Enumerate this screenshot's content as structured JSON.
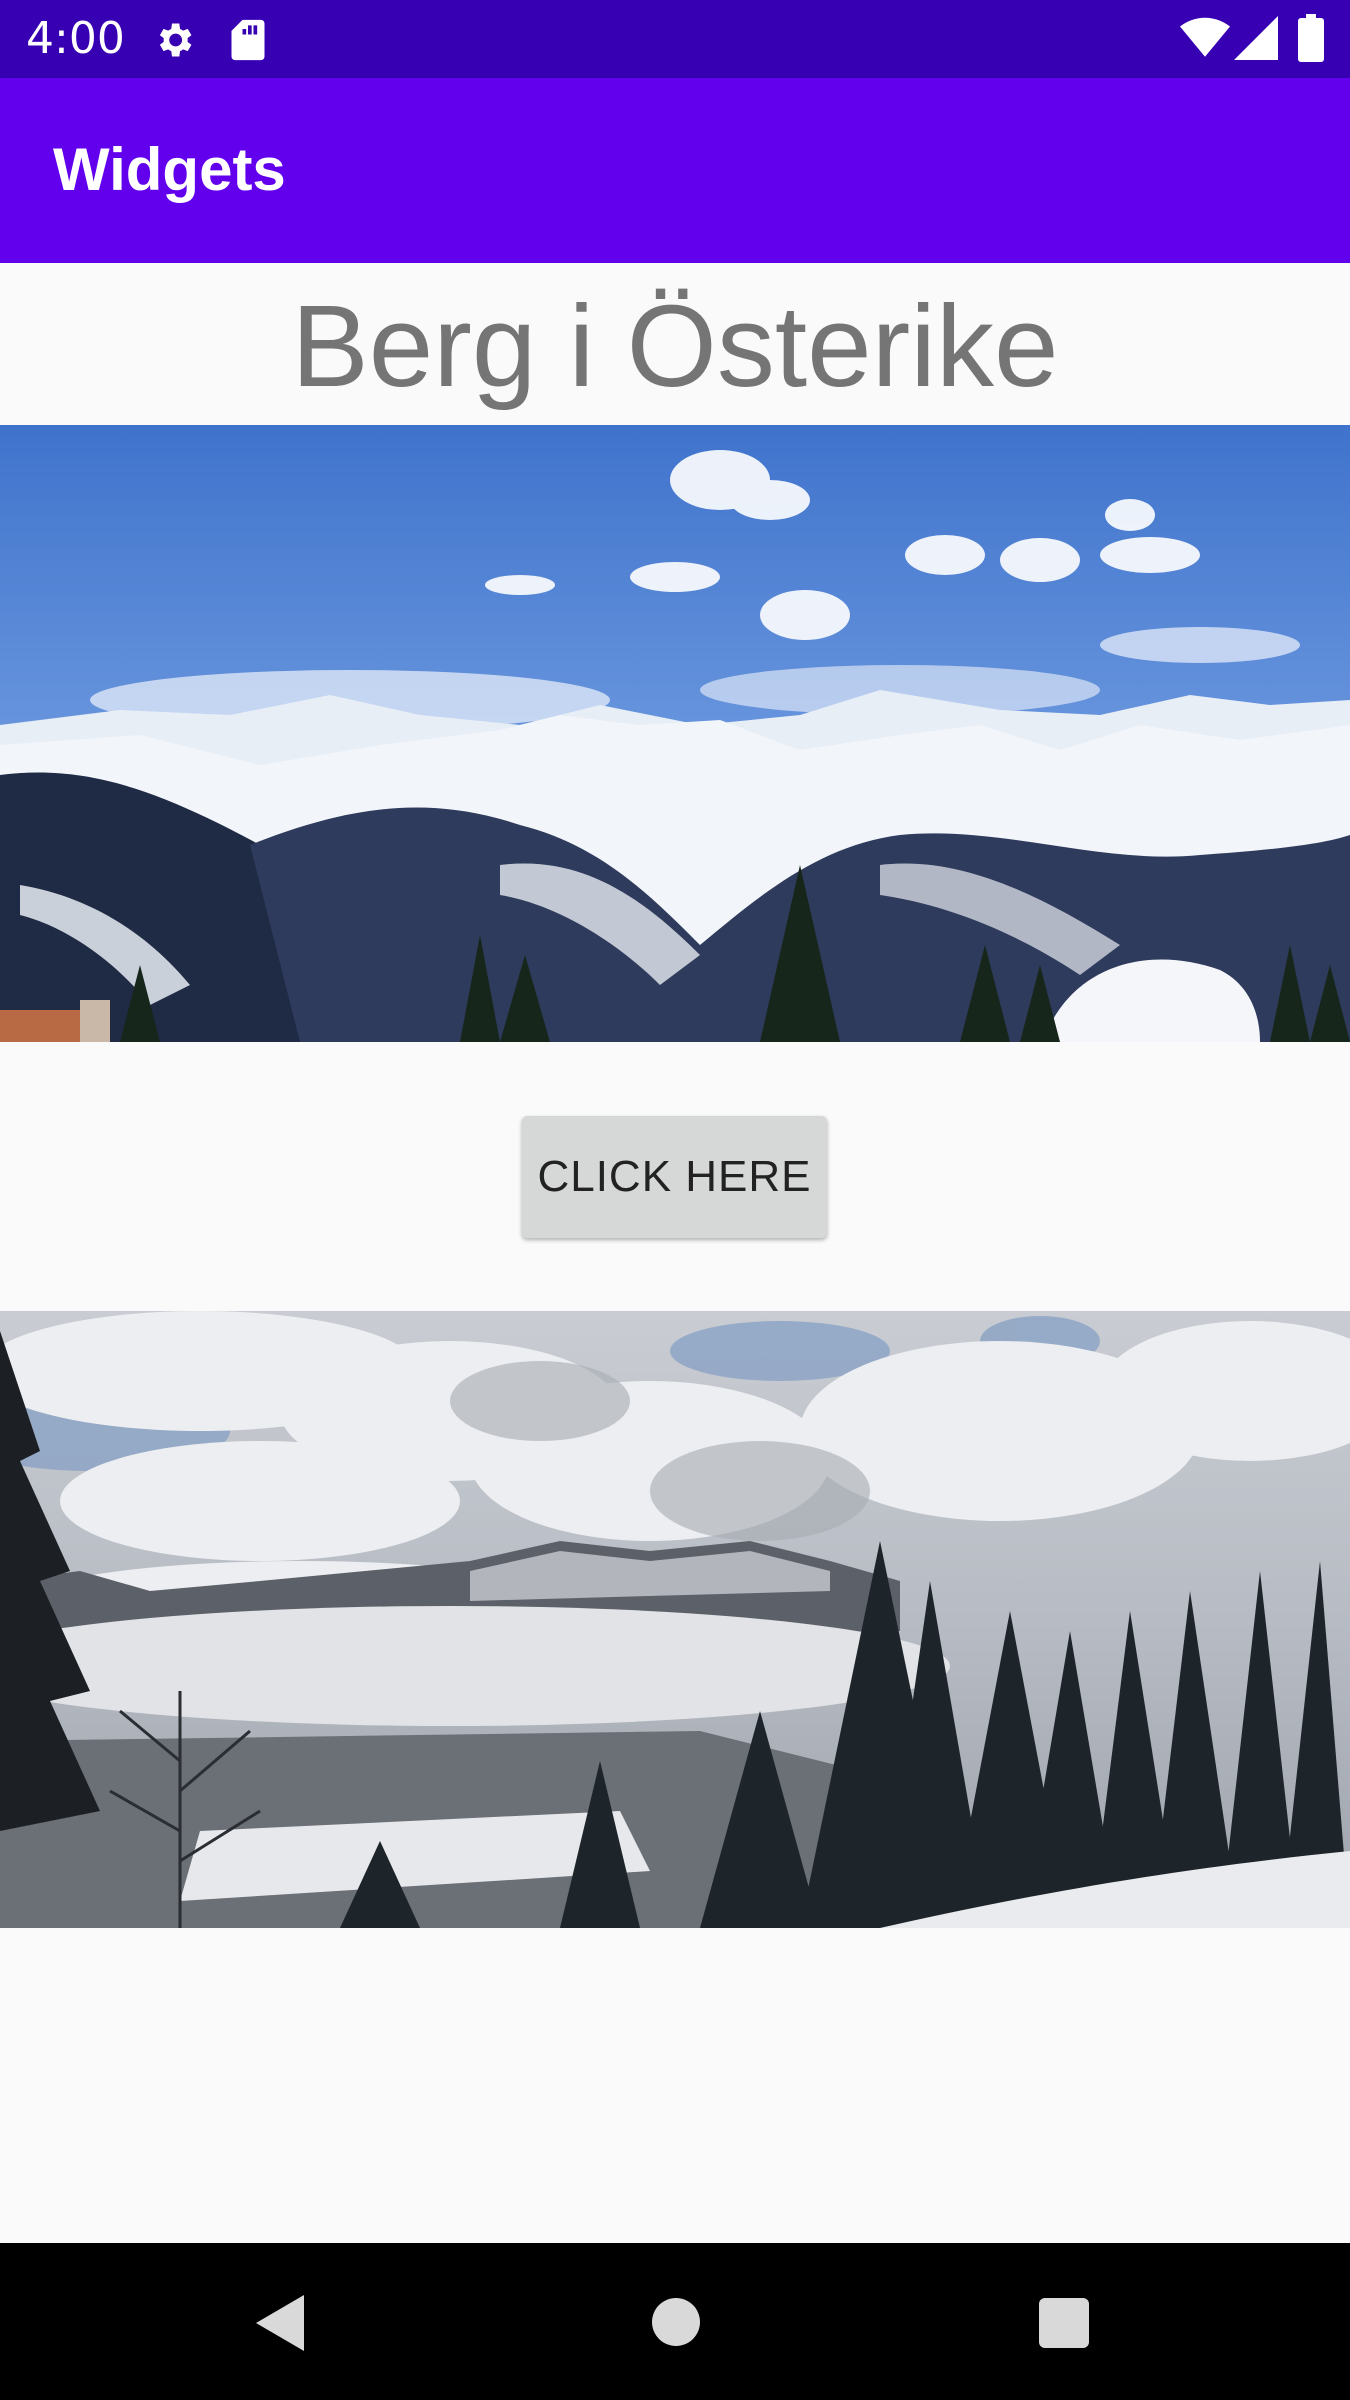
{
  "status_bar": {
    "time": "4:00",
    "icons": [
      "gear-icon",
      "sd-card-icon",
      "wifi-icon",
      "signal-icon",
      "battery-icon"
    ],
    "background": "#3700b3"
  },
  "app_bar": {
    "title": "Widgets",
    "background": "#6200ee"
  },
  "main": {
    "heading": "Berg i Österike",
    "images": [
      {
        "description": "mountain-panorama-image"
      },
      {
        "description": "cloudy-valley-forest-image"
      }
    ],
    "button_label": "CLICK HERE"
  },
  "nav_bar": {
    "buttons": [
      "back-icon",
      "home-icon",
      "recents-icon"
    ]
  }
}
